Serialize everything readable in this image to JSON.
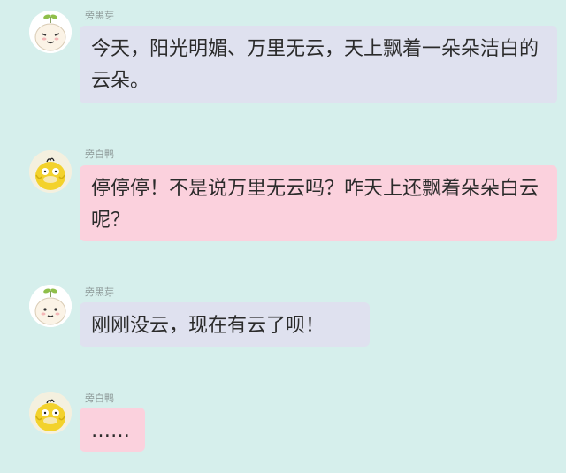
{
  "messages": [
    {
      "sender": "旁黑芽",
      "avatar_icon": "cartoon-sprout-face-avatar",
      "text": "今天，阳光明媚、万里无云，天上飘着一朵朵洁白的云朵。",
      "bubble_color": "#dfe1ef"
    },
    {
      "sender": "旁白鸭",
      "avatar_icon": "yellow-duck-avatar",
      "text": "停停停！不是说万里无云吗？咋天上还飘着朵朵白云呢？",
      "bubble_color": "#fbd1dd"
    },
    {
      "sender": "旁黑芽",
      "avatar_icon": "cartoon-sprout-face-avatar",
      "text": "刚刚没云，现在有云了呗！",
      "bubble_color": "#dfe1ef"
    },
    {
      "sender": "旁白鸭",
      "avatar_icon": "yellow-duck-avatar",
      "text": "……",
      "bubble_color": "#fbd1dd"
    }
  ],
  "colors": {
    "background": "#d6efec",
    "sender_name": "#8e9a99"
  }
}
